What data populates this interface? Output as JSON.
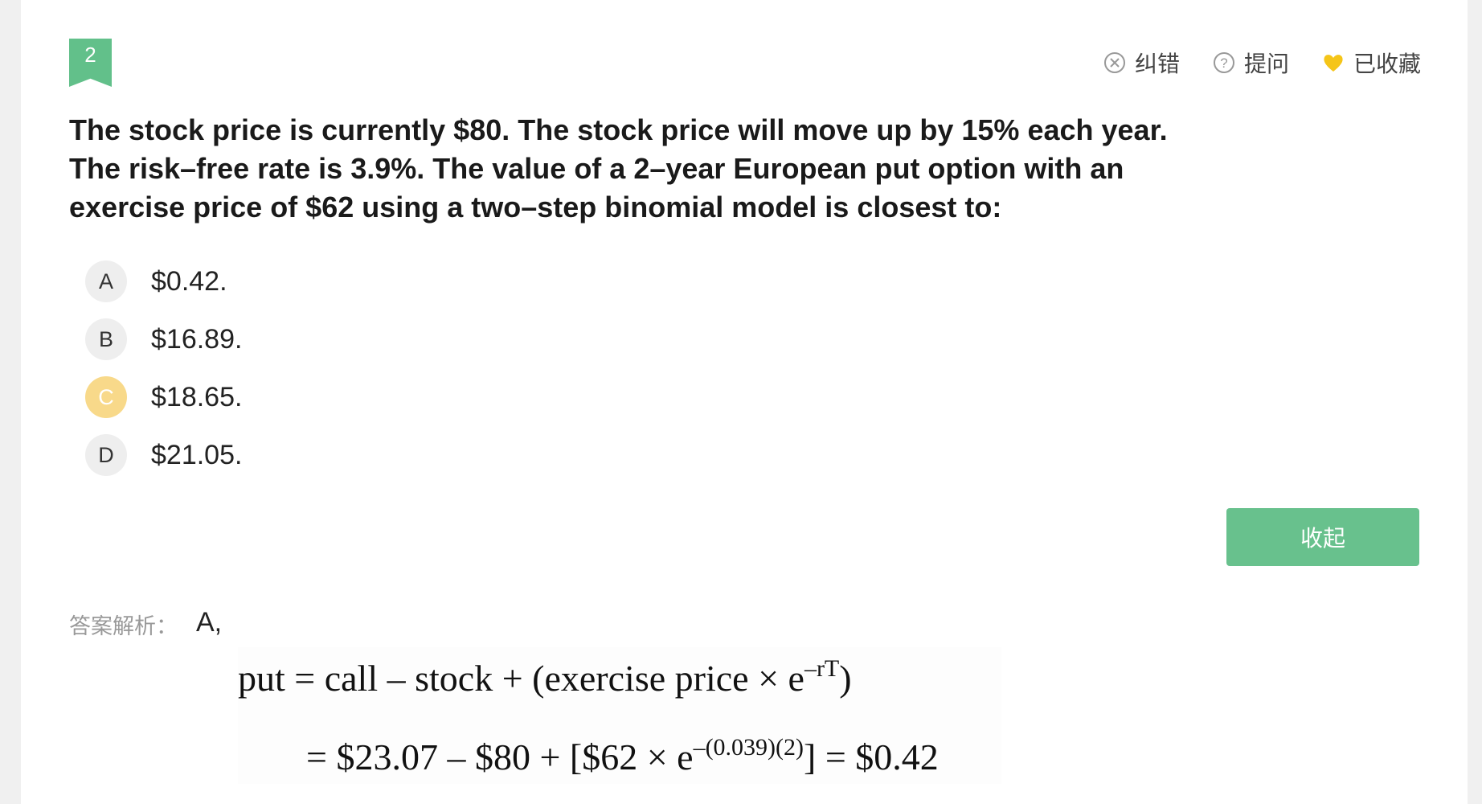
{
  "question": {
    "number": "2",
    "text": "The stock price is currently $80. The stock price will move up by 15% each year. The risk–free rate is 3.9%. The value of a 2–year European put option with an exercise price of $62 using a two–step binomial model is closest to:"
  },
  "toolbar": {
    "report_label": "纠错",
    "ask_label": "提问",
    "favorite_label": "已收藏"
  },
  "options": [
    {
      "letter": "A",
      "text": "$0.42."
    },
    {
      "letter": "B",
      "text": "$16.89."
    },
    {
      "letter": "C",
      "text": "$18.65."
    },
    {
      "letter": "D",
      "text": "$21.05."
    }
  ],
  "selected_option": "C",
  "collapse_label": "收起",
  "answer": {
    "label": "答案解析：",
    "value": "A,"
  },
  "formula": {
    "line1_main": "put  = call – stock + (exercise price × e",
    "line1_sup": "–rT",
    "line1_end": ")",
    "line2_main": "= $23.07 – $80 + [$62 × e",
    "line2_sup": "–(0.039)(2)",
    "line2_end": "] = $0.42"
  },
  "colors": {
    "accent_green": "#62c08a",
    "selected_yellow": "#f8d98a",
    "favorite_heart": "#f5c518"
  },
  "icons": [
    "close-circle-icon",
    "question-circle-icon",
    "heart-icon"
  ]
}
